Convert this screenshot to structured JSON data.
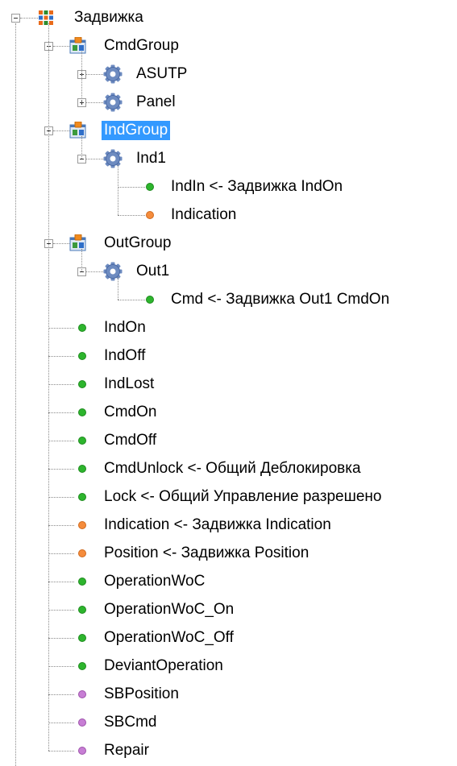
{
  "tree": {
    "root": {
      "label": "Задвижка",
      "icon": "grid-icon"
    },
    "groups": [
      {
        "label": "CmdGroup",
        "icon": "group-icon",
        "expanded": true,
        "children": [
          {
            "label": "ASUTP",
            "icon": "gear-icon",
            "expanded": false
          },
          {
            "label": "Panel",
            "icon": "gear-icon",
            "expanded": false
          }
        ]
      },
      {
        "label": "IndGroup",
        "icon": "group-icon",
        "expanded": true,
        "selected": true,
        "children": [
          {
            "label": "Ind1",
            "icon": "gear-icon",
            "expanded": true,
            "children": [
              {
                "label": "IndIn <- Задвижка IndOn",
                "color": "green"
              },
              {
                "label": "Indication",
                "color": "orange"
              }
            ]
          }
        ]
      },
      {
        "label": "OutGroup",
        "icon": "group-icon",
        "expanded": true,
        "children": [
          {
            "label": "Out1",
            "icon": "gear-icon",
            "expanded": true,
            "children": [
              {
                "label": "Cmd <- Задвижка Out1 CmdOn",
                "color": "green"
              }
            ]
          }
        ]
      }
    ],
    "signals": [
      {
        "label": "IndOn",
        "color": "green"
      },
      {
        "label": "IndOff",
        "color": "green"
      },
      {
        "label": "IndLost",
        "color": "green"
      },
      {
        "label": "CmdOn",
        "color": "green"
      },
      {
        "label": "CmdOff",
        "color": "green"
      },
      {
        "label": "CmdUnlock <- Общий Деблокировка",
        "color": "green"
      },
      {
        "label": "Lock <- Общий Управление разрешено",
        "color": "green"
      },
      {
        "label": "Indication <- Задвижка Indication",
        "color": "orange"
      },
      {
        "label": "Position <- Задвижка Position",
        "color": "orange"
      },
      {
        "label": "OperationWoC",
        "color": "green"
      },
      {
        "label": "OperationWoC_On",
        "color": "green"
      },
      {
        "label": "OperationWoC_Off",
        "color": "green"
      },
      {
        "label": "DeviantOperation",
        "color": "green"
      },
      {
        "label": "SBPosition",
        "color": "purple"
      },
      {
        "label": "SBCmd",
        "color": "purple"
      },
      {
        "label": "Repair",
        "color": "purple"
      }
    ],
    "colors": {
      "green": "#2db52d",
      "orange": "#f58c3c",
      "purple": "#c77ed4",
      "selection": "#3399ff"
    }
  }
}
